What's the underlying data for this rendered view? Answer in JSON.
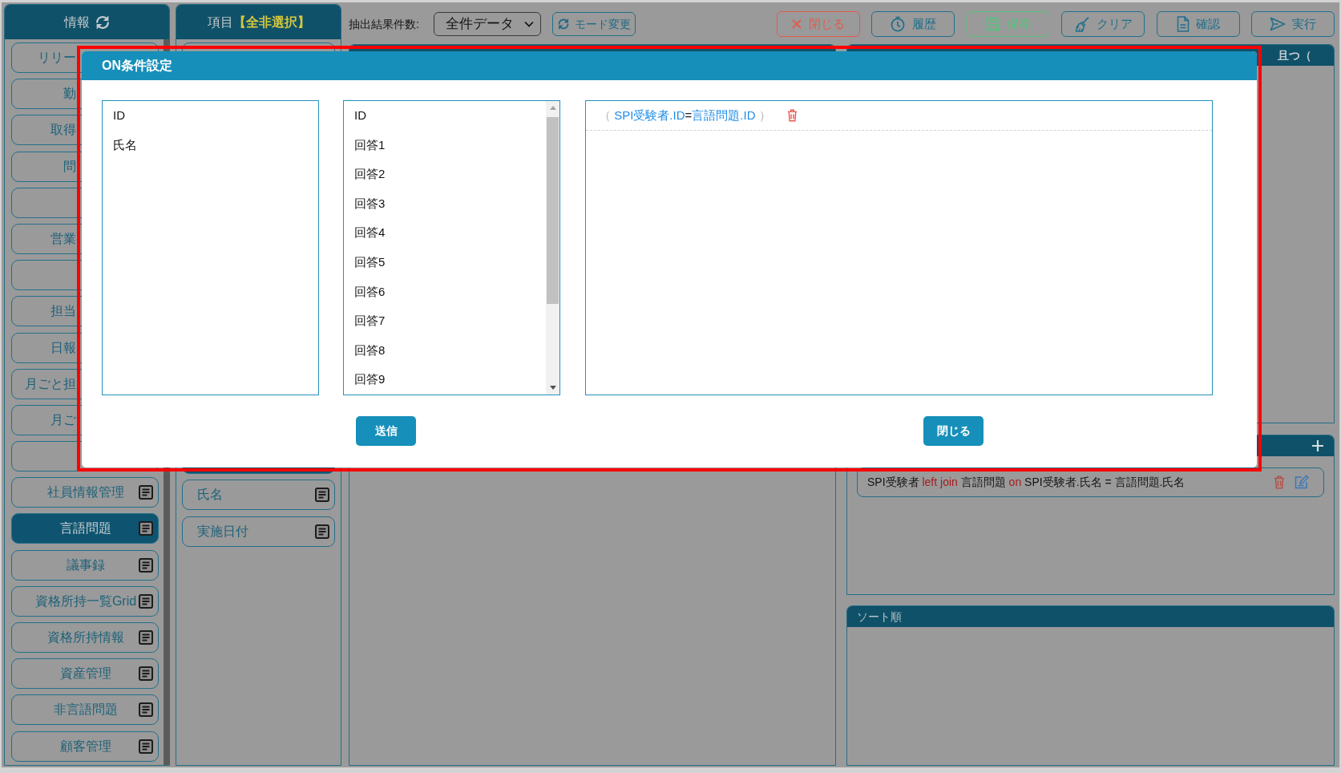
{
  "sidebar": {
    "title": "情報",
    "items": [
      {
        "label": "リリー",
        "kind": "covered",
        "selected": false
      },
      {
        "label": "勤",
        "kind": "covered",
        "selected": false
      },
      {
        "label": "取得",
        "kind": "covered",
        "selected": false
      },
      {
        "label": "問",
        "kind": "covered",
        "selected": false
      },
      {
        "kind": "covered",
        "selected": false
      },
      {
        "label": "営業",
        "kind": "covered",
        "selected": false
      },
      {
        "kind": "covered",
        "selected": false
      },
      {
        "label": "担当",
        "kind": "covered",
        "selected": false
      },
      {
        "label": "日報",
        "kind": "covered",
        "selected": false
      },
      {
        "label": "月ごと担",
        "kind": "covered",
        "selected": false
      },
      {
        "label": "月ご",
        "kind": "covered",
        "selected": false
      },
      {
        "kind": "covered",
        "selected": false
      },
      {
        "label": "社員情報管理",
        "kind": "plain",
        "selected": false
      },
      {
        "label": "言語問題",
        "kind": "plain",
        "selected": true
      },
      {
        "label": "議事録",
        "kind": "plain",
        "selected": false
      },
      {
        "label": "資格所持一覧Grid",
        "kind": "plain",
        "selected": false
      },
      {
        "label": "資格所持情報",
        "kind": "plain",
        "selected": false
      },
      {
        "label": "資産管理",
        "kind": "plain",
        "selected": false
      },
      {
        "label": "非言語問題",
        "kind": "plain",
        "selected": false
      },
      {
        "label": "顧客管理",
        "kind": "plain",
        "selected": false
      }
    ]
  },
  "fields": {
    "title": "項目",
    "toggle": "【全非選択】",
    "items": [
      {
        "kind": "covered",
        "selected": false
      },
      {
        "kind": "covered",
        "selected": true
      },
      {
        "label": "氏名",
        "kind": "plain",
        "selected": false
      },
      {
        "label": "実施日付",
        "kind": "plain",
        "selected": false
      }
    ]
  },
  "toolbar": {
    "count_label": "抽出結果件数:",
    "count_value": "全件データ",
    "mode_button": "モード変更",
    "actions": [
      {
        "label": "閉じる",
        "kind": "danger"
      },
      {
        "label": "履歴",
        "kind": "normal"
      },
      {
        "label": "保存",
        "kind": "success"
      },
      {
        "label": "クリア",
        "kind": "normal"
      },
      {
        "label": "確認",
        "kind": "normal"
      },
      {
        "label": "実行",
        "kind": "normal"
      }
    ]
  },
  "conditions_panel": {
    "header_button": "且つ（"
  },
  "join_panel": {
    "rows": [
      {
        "parts": [
          {
            "text": "SPI受験者",
            "kind": "table"
          },
          {
            "text": "left join",
            "kind": "keyword"
          },
          {
            "text": "言語問題",
            "kind": "table"
          },
          {
            "text": "on",
            "kind": "keyword"
          },
          {
            "text": "SPI受験者.氏名",
            "kind": "table"
          },
          {
            "text": "=",
            "kind": "operator"
          },
          {
            "text": "言語問題.氏名",
            "kind": "table"
          }
        ]
      }
    ]
  },
  "sort_panel": {
    "title": "ソート順"
  },
  "dialog": {
    "title": "ON条件設定",
    "left_columns": [
      {
        "label": "ID",
        "selected": false
      },
      {
        "label": "氏名",
        "selected": false
      }
    ],
    "right_columns": [
      {
        "label": "ID",
        "selected": false
      },
      {
        "label": "回答1",
        "selected": false
      },
      {
        "label": "回答2",
        "selected": false
      },
      {
        "label": "回答3",
        "selected": false
      },
      {
        "label": "回答4",
        "selected": false
      },
      {
        "label": "回答5",
        "selected": false
      },
      {
        "label": "回答6",
        "selected": false
      },
      {
        "label": "回答7",
        "selected": false
      },
      {
        "label": "回答8",
        "selected": false
      },
      {
        "label": "回答9",
        "selected": false
      }
    ],
    "conditions": [
      {
        "parts": [
          {
            "text": "（",
            "kind": "paren"
          },
          {
            "text": "SPI受験者.ID",
            "kind": "field"
          },
          {
            "text": "=",
            "kind": "operator"
          },
          {
            "text": "言語問題.ID",
            "kind": "field"
          },
          {
            "text": "）",
            "kind": "paren"
          }
        ]
      }
    ],
    "buttons": [
      "送信",
      "閉じる"
    ]
  }
}
